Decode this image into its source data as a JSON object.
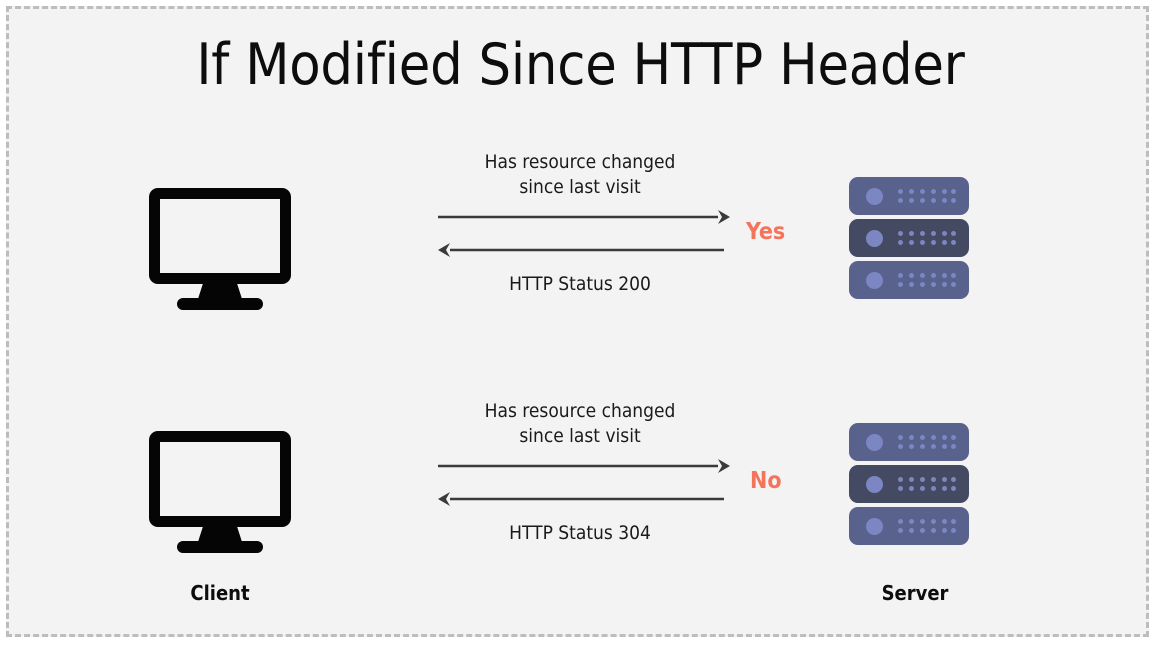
{
  "slide": {
    "title": "If Modified Since HTTP Header",
    "background_color": "#f3f3f3",
    "frame_border_color": "#bdbdbd",
    "frame_border_style": "dashed"
  },
  "colors": {
    "accent_answer": "#f4735b",
    "arrow": "#3a3a3a",
    "text": "#1a1a1a",
    "server_bar_light": "#59628c",
    "server_bar_dark": "#434a61",
    "server_dot": "#7b86c2",
    "monitor_outline": "#050505"
  },
  "endpoints": {
    "client_label": "Client",
    "server_label": "Server",
    "client_icon": "monitor-icon",
    "server_icon": "server-rack-icon"
  },
  "flows": [
    {
      "id": "flow-modified",
      "request_label_line1": "Has resource changed",
      "request_label_line2": "since last visit",
      "response_label": "HTTP Status 200",
      "answer": "Yes",
      "request_direction": "client-to-server",
      "response_direction": "server-to-client"
    },
    {
      "id": "flow-not-modified",
      "request_label_line1": "Has resource changed",
      "request_label_line2": "since last visit",
      "response_label": "HTTP Status 304",
      "answer": "No",
      "request_direction": "client-to-server",
      "response_direction": "server-to-client"
    }
  ]
}
